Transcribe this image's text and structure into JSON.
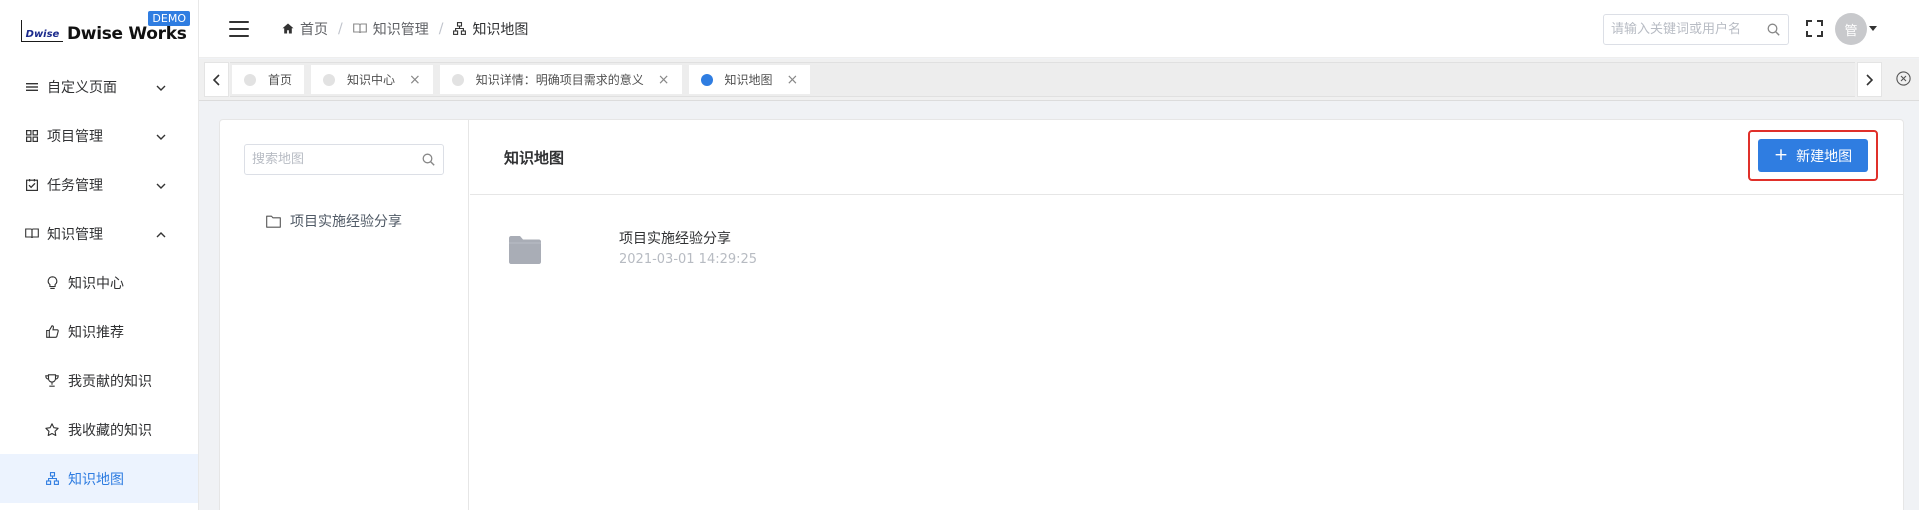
{
  "brand": {
    "logo_mark": "Dwise",
    "name": "Dwise Works",
    "badge": "DEMO"
  },
  "sidebar": {
    "menus": [
      {
        "label": "自定义页面",
        "icon": "list-icon",
        "expanded": false
      },
      {
        "label": "项目管理",
        "icon": "grid-icon",
        "expanded": false
      },
      {
        "label": "任务管理",
        "icon": "checkbox-icon",
        "expanded": false
      },
      {
        "label": "知识管理",
        "icon": "book-icon",
        "expanded": true
      }
    ],
    "sub_items": [
      {
        "label": "知识中心",
        "icon": "lightbulb-icon"
      },
      {
        "label": "知识推荐",
        "icon": "thumbs-up-icon"
      },
      {
        "label": "我贡献的知识",
        "icon": "trophy-icon"
      },
      {
        "label": "我收藏的知识",
        "icon": "star-icon"
      },
      {
        "label": "知识地图",
        "icon": "sitemap-icon",
        "active": true
      }
    ]
  },
  "header": {
    "breadcrumb": [
      "首页",
      "知识管理",
      "知识地图"
    ],
    "search_placeholder": "请输入关键词或用户名",
    "avatar_text": "管"
  },
  "tabs": [
    {
      "label": "首页",
      "closable": false,
      "active": false
    },
    {
      "label": "知识中心",
      "closable": true,
      "active": false
    },
    {
      "label": "知识详情：明确项目需求的意义",
      "closable": true,
      "active": false
    },
    {
      "label": "知识地图",
      "closable": true,
      "active": true
    }
  ],
  "tab_close_glyph": "×",
  "left_panel": {
    "search_placeholder": "搜索地图",
    "tree": [
      {
        "label": "项目实施经验分享"
      }
    ]
  },
  "main": {
    "title": "知识地图",
    "new_button": "新建地图",
    "new_button_plus": "+",
    "maps": [
      {
        "name": "项目实施经验分享",
        "date": "2021-03-01 14:29:25"
      }
    ]
  },
  "colors": {
    "primary": "#2f7de1",
    "highlight_frame": "#e0302a",
    "active_bg": "#ecf3fe"
  }
}
